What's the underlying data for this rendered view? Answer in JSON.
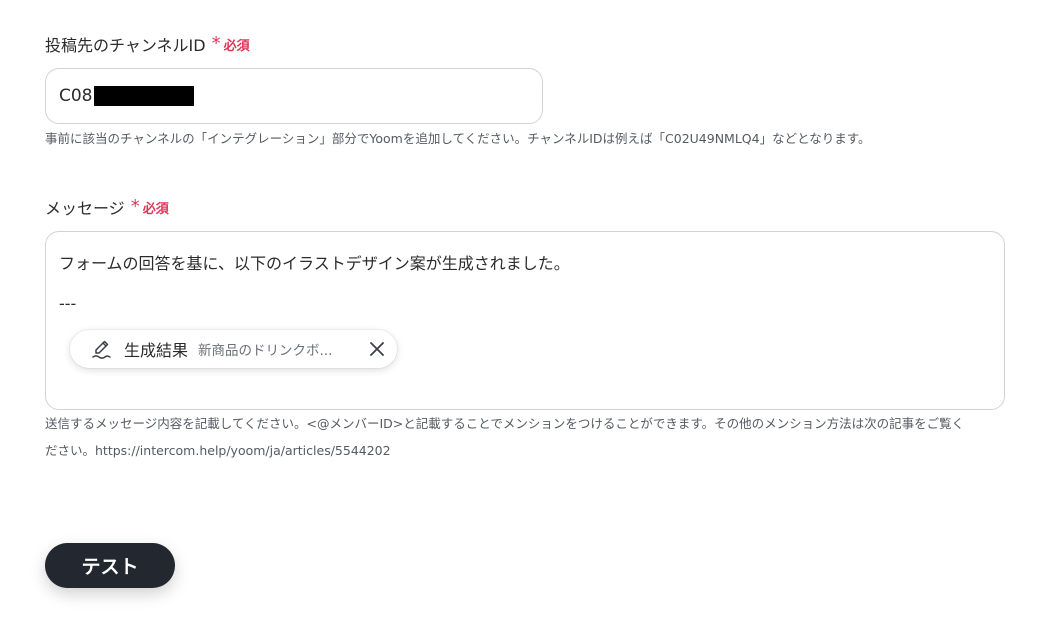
{
  "channel_field": {
    "label": "投稿先のチャンネルID",
    "required_mark": "*",
    "required_text": "必須",
    "value_prefix": "C08",
    "help": "事前に該当のチャンネルの「インテグレーション」部分でYoomを追加してください。チャンネルIDは例えば「C02U49NMLQ4」などとなります。"
  },
  "message_field": {
    "label": "メッセージ",
    "required_mark": "*",
    "required_text": "必須",
    "line1": "フォームの回答を基に、以下のイラストデザイン案が生成されました。",
    "line2": "---",
    "chip": {
      "icon": "pen-icon",
      "label": "生成結果",
      "value": "新商品のドリンクボ..."
    },
    "help_line1": "送信するメッセージ内容を記載してください。<@メンバーID>と記載することでメンションをつけることができます。その他のメンション方法は次の記事をご覧く",
    "help_line2": "ださい。https://intercom.help/yoom/ja/articles/5544202"
  },
  "test_button": {
    "label": "テスト"
  },
  "colors": {
    "required": "#e0365a",
    "button_bg": "#23272f",
    "border": "#cfd3d9"
  }
}
